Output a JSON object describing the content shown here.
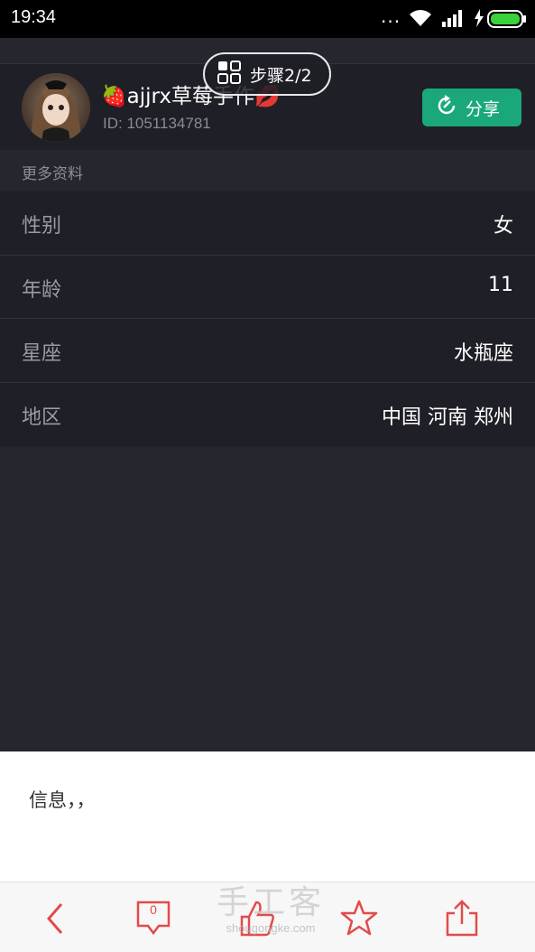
{
  "status_bar": {
    "time": "19:34",
    "dots": "...",
    "battery_color": "#3ad13a"
  },
  "profile": {
    "username": "🍓ajjrx草莓手作💋",
    "user_id": "ID: 1051134781",
    "share_label": "分享",
    "share_color": "#1aa87a"
  },
  "step_pill": {
    "label": "步骤2/2"
  },
  "section": {
    "title": "更多资料"
  },
  "info": [
    {
      "key": "性别",
      "value": "女"
    },
    {
      "key": "年龄",
      "value": "11"
    },
    {
      "key": "星座",
      "value": "水瓶座"
    },
    {
      "key": "地区",
      "value": "中国 河南 郑州"
    }
  ],
  "message": {
    "text": "信息，，"
  },
  "toolbar": {
    "comment_count": "0",
    "accent_color": "#e24b4b",
    "icons": [
      "back-icon",
      "comment-icon",
      "like-icon",
      "favorite-icon",
      "share-icon"
    ]
  },
  "watermark": {
    "title": "手工客",
    "url": "shougongke.com"
  }
}
